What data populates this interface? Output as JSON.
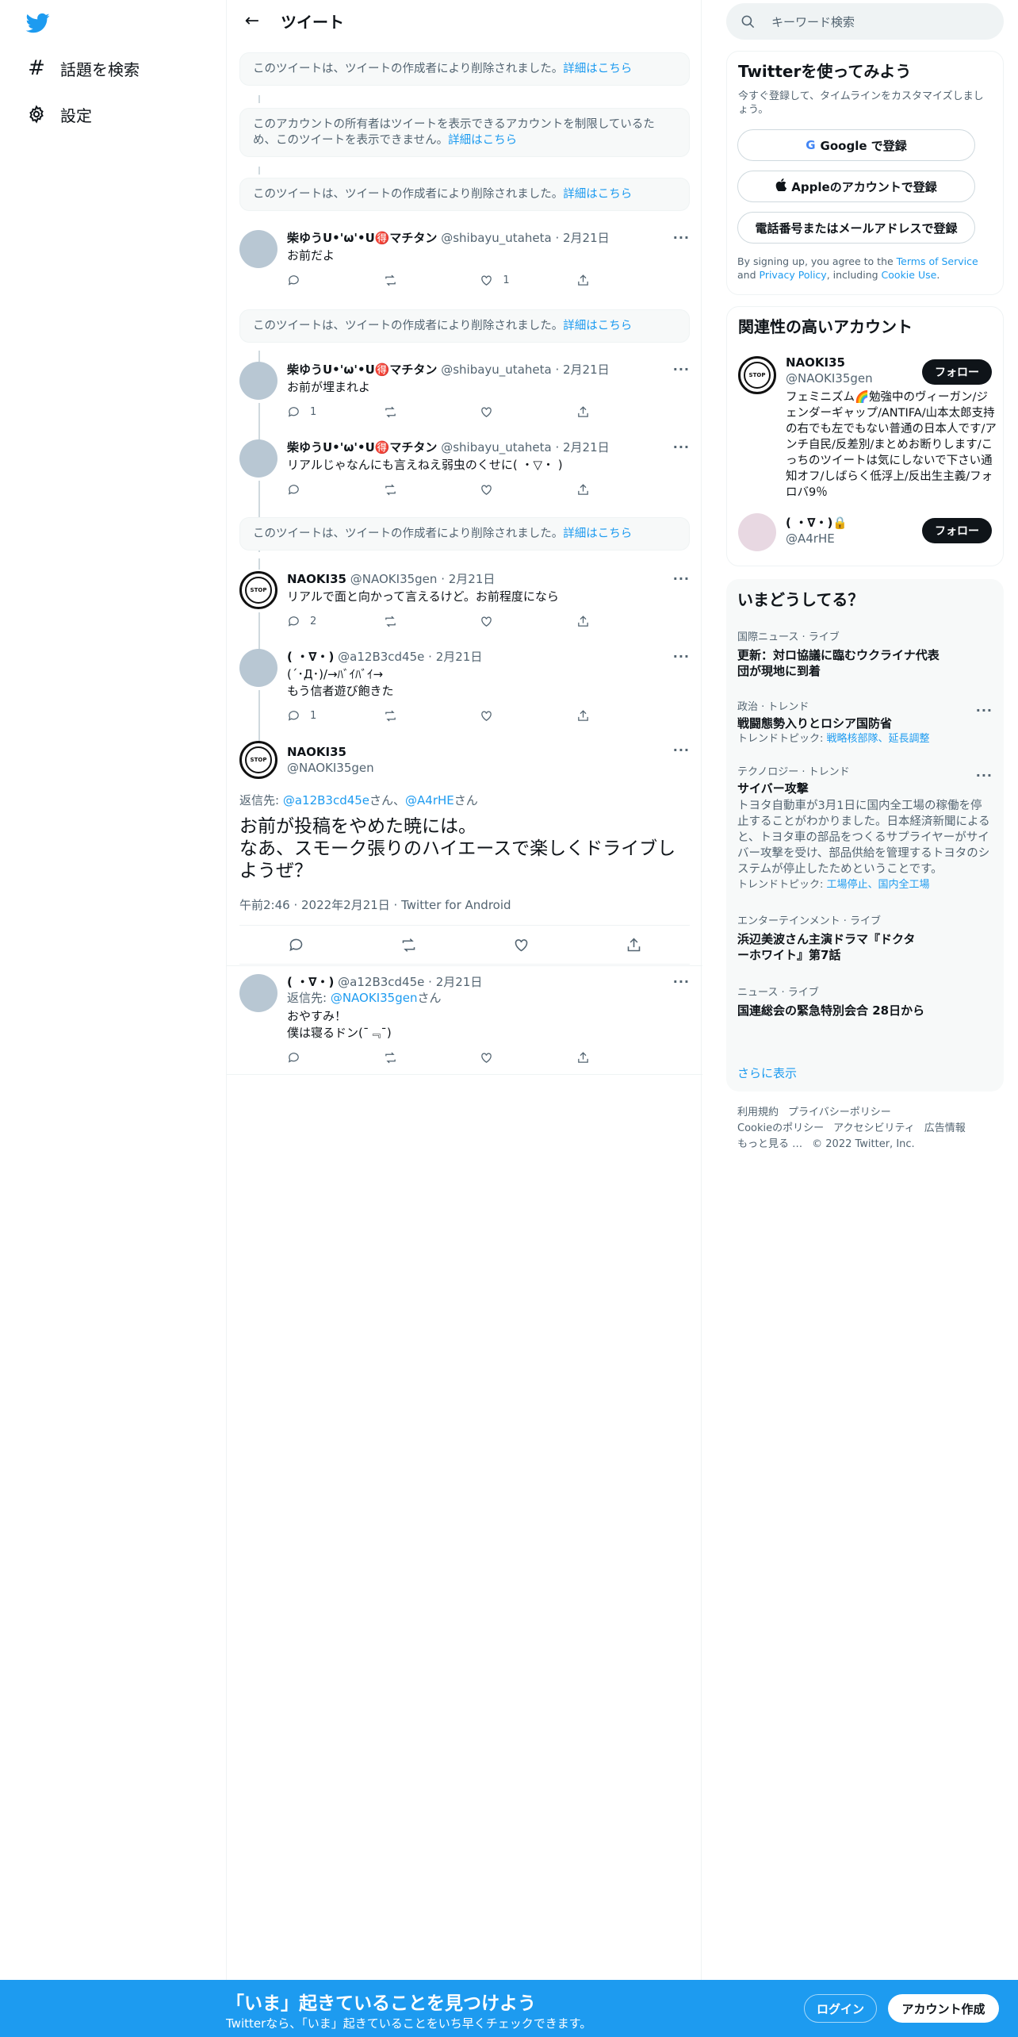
{
  "colors": {
    "accent": "#1d9bf0",
    "text": "#0f1419",
    "muted": "#536471",
    "panel": "#f7f9f9"
  },
  "nav": {
    "logo_icon": "twitter-bird-icon",
    "items": [
      {
        "label": "話題を検索",
        "icon": "hashtag-icon"
      },
      {
        "label": "設定",
        "icon": "gear-icon"
      }
    ]
  },
  "header": {
    "title": "ツイート"
  },
  "deleted_text": "このツイートは、ツイートの作成者により削除されました。",
  "restricted_text": "このアカウントの所有者はツイートを表示できるアカウントを制限しているため、このツイートを表示できません。",
  "details_link": "詳細はこちら",
  "tweets": [
    {
      "name": "柴ゆうU•'ω'•U🉐マチタン",
      "handle": "@shibayu_utaheta",
      "date": "2月21日",
      "text": "お前だよ",
      "reply": "",
      "retweet": "",
      "like": "1"
    },
    {
      "name": "柴ゆうU•'ω'•U🉐マチタン",
      "handle": "@shibayu_utaheta",
      "date": "2月21日",
      "text": "お前が埋まれよ",
      "reply": "1",
      "retweet": "",
      "like": ""
    },
    {
      "name": "柴ゆうU•'ω'•U🉐マチタン",
      "handle": "@shibayu_utaheta",
      "date": "2月21日",
      "text": "リアルじゃなんにも言えねえ弱虫のくせに( ・▽・ )",
      "reply": "",
      "retweet": "",
      "like": ""
    },
    {
      "name": "NAOKI35",
      "handle": "@NAOKI35gen",
      "date": "2月21日",
      "text": "リアルで面と向かって言えるけど。お前程度になら",
      "reply": "2",
      "retweet": "",
      "like": ""
    },
    {
      "name": "( ・∇・)",
      "handle": "@a12B3cd45e",
      "date": "2月21日",
      "text": "(´･Д･)/→ﾊﾞｲﾊﾞｲ→\nもう信者遊び飽きた",
      "reply": "1",
      "retweet": "",
      "like": ""
    }
  ],
  "focused": {
    "name": "NAOKI35",
    "handle": "@NAOKI35gen",
    "reply_prefix": "返信先: ",
    "reply_to_1": "@a12B3cd45e",
    "san1": "さん、",
    "reply_to_2": "@A4rHE",
    "san2": "さん",
    "text": "お前が投稿をやめた暁には。\nなあ、スモーク張りのハイエースで楽しくドライブしようぜ？",
    "meta": "午前2:46 · 2022年2月21日 · Twitter for Android"
  },
  "last_reply": {
    "name": "( ・∇・)",
    "handle": "@a12B3cd45e",
    "date": "2月21日",
    "reply_prefix": "返信先: ",
    "reply_to": "@NAOKI35gen",
    "san": "さん",
    "text": "おやすみ！\n僕は寝るドン(¯﹃¯)"
  },
  "search": {
    "placeholder": "キーワード検索"
  },
  "signup": {
    "title": "Twitterを使ってみよう",
    "subtitle": "今すぐ登録して、タイムラインをカスタマイズしましょう。",
    "google": "Google で登録",
    "apple": "Appleのアカウントで登録",
    "phone": "電話番号またはメールアドレスで登録",
    "terms_pre": "By signing up, you agree to the ",
    "terms": "Terms of Service",
    "and": " and ",
    "privacy": "Privacy Policy",
    "including": ", including ",
    "cookie": "Cookie Use",
    "dot": "."
  },
  "related": {
    "title": "関連性の高いアカウント",
    "accounts": [
      {
        "name": "NAOKI35",
        "handle": "@NAOKI35gen",
        "bio": "フェミニズム🌈勉強中のヴィーガン/ジェンダーギャップ/ANTIFA/山本太郎支持の右でも左でもない普通の日本人です/アンチ自民/反差別/まとめお断りします/こっちのツイートは気にしないで下さい通知オフ/しばらく低浮上/反出生主義/フォロバ9％",
        "follow": "フォロー"
      },
      {
        "name": "( ・∇・)🔒",
        "handle": "@A4rHE",
        "follow": "フォロー"
      }
    ]
  },
  "trends": {
    "title": "いまどうしてる？",
    "items": [
      {
        "cat": "国際ニュース · ライブ",
        "title": "更新：対ロ協議に臨むウクライナ代表団が現地に到着"
      },
      {
        "cat": "政治 · トレンド",
        "title": "戦闘態勢入りとロシア国防省",
        "topics_label": "トレンドトピック: ",
        "topics": "戦略核部隊、延長調整"
      },
      {
        "cat": "テクノロジー · トレンド",
        "title": "サイバー攻撃",
        "desc": "トヨタ自動車が3月1日に国内全工場の稼働を停止することがわかりました。日本経済新聞によると、トヨタ車の部品をつくるサプライヤーがサイバー攻撃を受け、部品供給を管理するトヨタのシステムが停止したためということです。",
        "topics_label": "トレンドトピック: ",
        "topics": "工場停止、国内全工場"
      },
      {
        "cat": "エンターテインメント · ライブ",
        "title": "浜辺美波さん主演ドラマ『ドクターホワイト』第7話"
      },
      {
        "cat": "ニュース · ライブ",
        "title": "国連総会の緊急特別会合 28日から"
      }
    ],
    "more": "さらに表示"
  },
  "footer": {
    "terms": "利用規約",
    "privacy": "プライバシーポリシー",
    "cookie": "Cookieのポリシー",
    "accessibility": "アクセシビリティ",
    "ads": "広告情報",
    "more": "もっと見る …",
    "copyright": "© 2022 Twitter, Inc."
  },
  "bottombar": {
    "title": "「いま」起きていることを見つけよう",
    "subtitle": "Twitterなら、「いま」起きていることをいち早くチェックできます。",
    "login": "ログイン",
    "signup": "アカウント作成"
  }
}
